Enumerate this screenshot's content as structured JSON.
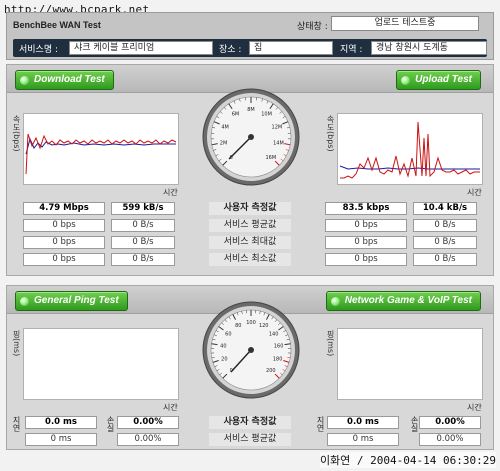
{
  "watermark_top": "http://www.bcpark.net",
  "watermark_bottom": "이화연 / 2004-04-14 06:30:29",
  "app_title": "BenchBee WAN Test",
  "header": {
    "status_label": "상태창 :",
    "status_value": "업로드 테스트중",
    "service_label": "서비스명 :",
    "service_value": "샤크 케이블 프리미엄",
    "place_label": "장소 :",
    "place_value": "집",
    "region_label": "지역 :",
    "region_value": "경남 창원시 도계동"
  },
  "buttons": {
    "download": "Download Test",
    "upload": "Upload Test",
    "ping": "General Ping Test",
    "game": "Network Game & VoIP Test"
  },
  "graph_labels": {
    "speed_y": "속도(bps)",
    "ping_y": "핑(ms)",
    "x": "시간"
  },
  "gauge_ticks": [
    "0",
    "2M",
    "4M",
    "6M",
    "8M",
    "10M",
    "12M",
    "14M",
    "16M"
  ],
  "ping_gauge_ticks": [
    "0",
    "20",
    "40",
    "60",
    "80",
    "100",
    "120",
    "140",
    "160",
    "180",
    "200"
  ],
  "metric_labels": [
    "사용자 측정값",
    "서비스 평균값",
    "서비스 최대값",
    "서비스 최소값"
  ],
  "download_values": [
    [
      "4.79 Mbps",
      "599 kB/s"
    ],
    [
      "0 bps",
      "0 B/s"
    ],
    [
      "0 bps",
      "0 B/s"
    ],
    [
      "0 bps",
      "0 B/s"
    ]
  ],
  "upload_values": [
    [
      "83.5 kbps",
      "10.4 kB/s"
    ],
    [
      "0 bps",
      "0 B/s"
    ],
    [
      "0 bps",
      "0 B/s"
    ],
    [
      "0 bps",
      "0 B/s"
    ]
  ],
  "ping": {
    "side_labels": [
      "지연",
      "손실"
    ],
    "metric_labels": [
      "사용자 측정값",
      "서비스 평균값"
    ],
    "left": [
      [
        "0.0 ms",
        "0.00%"
      ],
      [
        "0 ms",
        "0.00%"
      ]
    ],
    "right": [
      [
        "0.0 ms",
        "0.00%"
      ],
      [
        "0 ms",
        "0.00%"
      ]
    ]
  },
  "colors": {
    "green": "#2f9a1e",
    "series_red": "#cc1111",
    "series_blue": "#1a1aa0"
  }
}
